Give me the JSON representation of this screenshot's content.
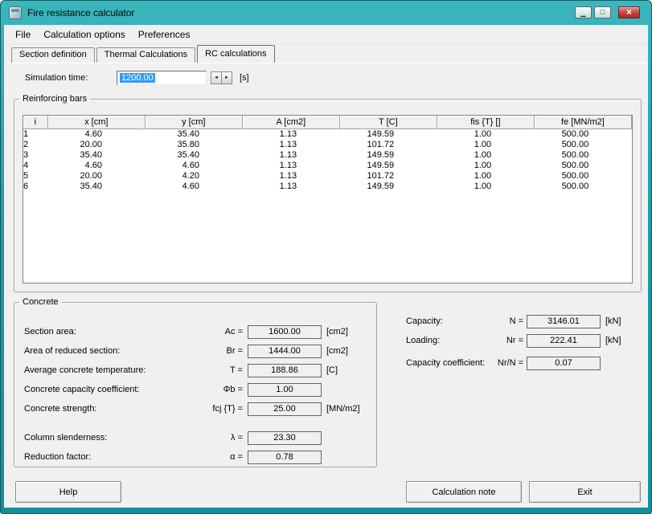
{
  "window": {
    "title": "Fire resistance calculator"
  },
  "window_controls": {
    "minimize_glyph": "▁",
    "maximize_glyph": "□",
    "close_glyph": "×"
  },
  "menu": {
    "items": [
      "File",
      "Calculation options",
      "Preferences"
    ]
  },
  "tabs": [
    {
      "label": "Section definition",
      "active": false
    },
    {
      "label": "Thermal Calculations",
      "active": false
    },
    {
      "label": "RC calculations",
      "active": true
    }
  ],
  "simulation": {
    "label": "Simulation time:",
    "value": "1200.00",
    "unit": "[s]",
    "spin_left_glyph": "◄",
    "spin_right_glyph": "►"
  },
  "bars": {
    "group_label": "Reinforcing bars",
    "columns": [
      "i",
      "x [cm]",
      "y [cm]",
      "A [cm2]",
      "T [C]",
      "fis {T} []",
      "fe [MN/m2]"
    ],
    "rows": [
      [
        "1",
        "4.60",
        "35.40",
        "1.13",
        "149.59",
        "1.00",
        "500.00"
      ],
      [
        "2",
        "20.00",
        "35.80",
        "1.13",
        "101.72",
        "1.00",
        "500.00"
      ],
      [
        "3",
        "35.40",
        "35.40",
        "1.13",
        "149.59",
        "1.00",
        "500.00"
      ],
      [
        "4",
        "4.60",
        "4.60",
        "1.13",
        "149.59",
        "1.00",
        "500.00"
      ],
      [
        "5",
        "20.00",
        "4.20",
        "1.13",
        "101.72",
        "1.00",
        "500.00"
      ],
      [
        "6",
        "35.40",
        "4.60",
        "1.13",
        "149.59",
        "1.00",
        "500.00"
      ]
    ]
  },
  "concrete": {
    "group_label": "Concrete",
    "rows": [
      {
        "label": "Section area:",
        "symbol": "Ac =",
        "value": "1600.00",
        "unit": "[cm2]"
      },
      {
        "label": "Area of reduced section:",
        "symbol": "Br =",
        "value": "1444.00",
        "unit": "[cm2]"
      },
      {
        "label": "Average concrete temperature:",
        "symbol": "T =",
        "value": "188.86",
        "unit": "[C]"
      },
      {
        "label": "Concrete capacity coefficient:",
        "symbol": "Φb =",
        "value": "1.00",
        "unit": ""
      },
      {
        "label": "Concrete strength:",
        "symbol": "fcj {T} =",
        "value": "25.00",
        "unit": "[MN/m2]"
      },
      {
        "label": "Column slenderness:",
        "symbol": "λ =",
        "value": "23.30",
        "unit": ""
      },
      {
        "label": "Reduction factor:",
        "symbol": "α =",
        "value": "0.78",
        "unit": ""
      }
    ]
  },
  "capacity": {
    "rows": [
      {
        "label": "Capacity:",
        "symbol": "N =",
        "value": "3146.01",
        "unit": "[kN]"
      },
      {
        "label": "Loading:",
        "symbol": "Nr =",
        "value": "222.41",
        "unit": "[kN]"
      },
      {
        "label": "Capacity coefficient:",
        "symbol": "Nr/N =",
        "value": "0.07",
        "unit": ""
      }
    ]
  },
  "footer": {
    "help": "Help",
    "calculation_note": "Calculation note",
    "exit": "Exit"
  },
  "colors": {
    "titlebar": "#1d9ba3",
    "selection": "#3399ff",
    "close_button": "#c23b35"
  }
}
